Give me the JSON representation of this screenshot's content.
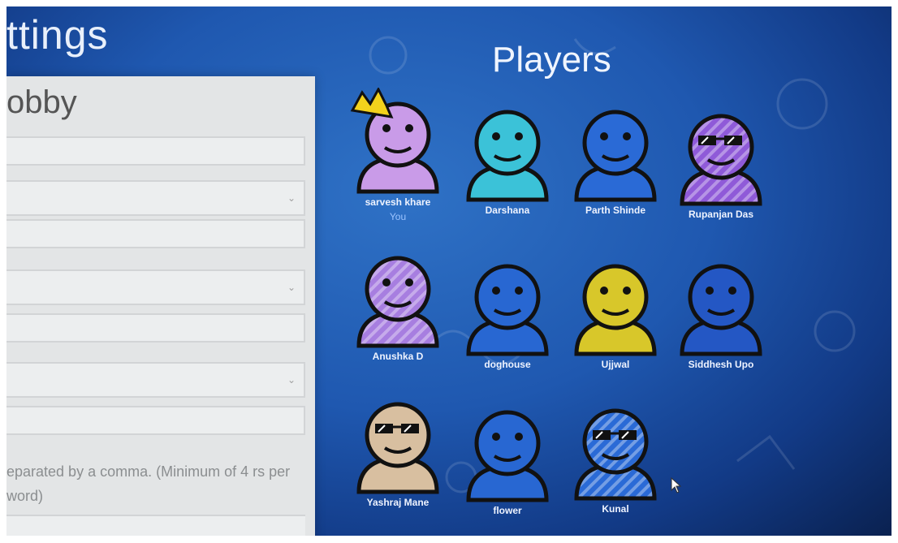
{
  "settings": {
    "title": "ttings",
    "lobby_heading": "obby",
    "hint_text": "eparated by a comma. (Minimum of 4 rs per word)"
  },
  "players": {
    "title": "Players",
    "list": [
      {
        "name": "sarvesh khare",
        "subtitle": "You",
        "crown": true,
        "color": "#c99be8",
        "accessory": "none",
        "stripes": false
      },
      {
        "name": "Darshana",
        "color": "#3bc2d8",
        "accessory": "none",
        "stripes": false
      },
      {
        "name": "Parth Shinde",
        "color": "#2a6ad6",
        "accessory": "none",
        "stripes": false
      },
      {
        "name": "Rupanjan Das",
        "color": "#8f5ad8",
        "accessory": "sunglasses",
        "stripes": true
      },
      {
        "name": "Anushka D",
        "color": "#a77ee0",
        "accessory": "none",
        "stripes": true
      },
      {
        "name": "doghouse",
        "color": "#2867d2",
        "accessory": "none",
        "stripes": false
      },
      {
        "name": "Ujjwal",
        "color": "#d8c72a",
        "accessory": "none",
        "stripes": false
      },
      {
        "name": "Siddhesh Upo",
        "color": "#2457c4",
        "accessory": "none",
        "stripes": false
      },
      {
        "name": "Yashraj Mane",
        "color": "#d8bfa0",
        "accessory": "sunglasses",
        "stripes": false
      },
      {
        "name": "flower",
        "color": "#2867d2",
        "accessory": "none",
        "stripes": false
      },
      {
        "name": "Kunal",
        "color": "#2a6ad6",
        "accessory": "sunglasses",
        "stripes": true
      }
    ]
  }
}
